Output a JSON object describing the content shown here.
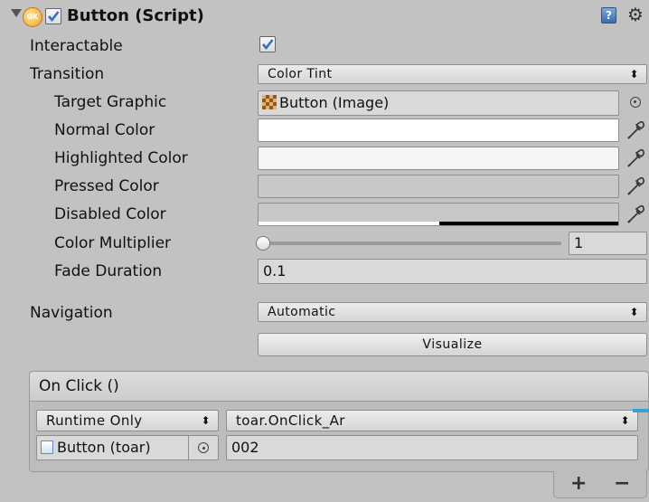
{
  "component": {
    "title": "Button (Script)",
    "ok_badge": "OK",
    "enabled": true
  },
  "props": {
    "interactable_label": "Interactable",
    "interactable_checked": true,
    "transition_label": "Transition",
    "transition_value": "Color Tint",
    "target_graphic_label": "Target Graphic",
    "target_graphic_value": "Button (Image)",
    "normal_color_label": "Normal Color",
    "normal_color": "#ffffff",
    "highlighted_color_label": "Highlighted Color",
    "highlighted_color": "#f5f5f5",
    "pressed_color_label": "Pressed Color",
    "pressed_color": "#c8c8c8",
    "disabled_color_label": "Disabled Color",
    "disabled_color": "#c8c8c8",
    "color_multiplier_label": "Color Multiplier",
    "color_multiplier_value": "1",
    "fade_duration_label": "Fade Duration",
    "fade_duration_value": "0.1",
    "navigation_label": "Navigation",
    "navigation_value": "Automatic",
    "visualize_label": "Visualize"
  },
  "onclick": {
    "header": "On Click ()",
    "runtime_value": "Runtime Only",
    "function_value": "toar.OnClick_Ar",
    "object_value": "Button (toar)",
    "argument_value": "002",
    "add_label": "+",
    "remove_label": "−"
  },
  "colors": {
    "panel_bg": "#c2c2c2",
    "accent_blue": "#2a73c9"
  },
  "icons": {
    "script_help": "help-book-icon",
    "settings": "gear-icon",
    "foldout": "triangle-down-icon",
    "picker": "object-picker-icon",
    "eyedropper": "eyedropper-icon"
  }
}
